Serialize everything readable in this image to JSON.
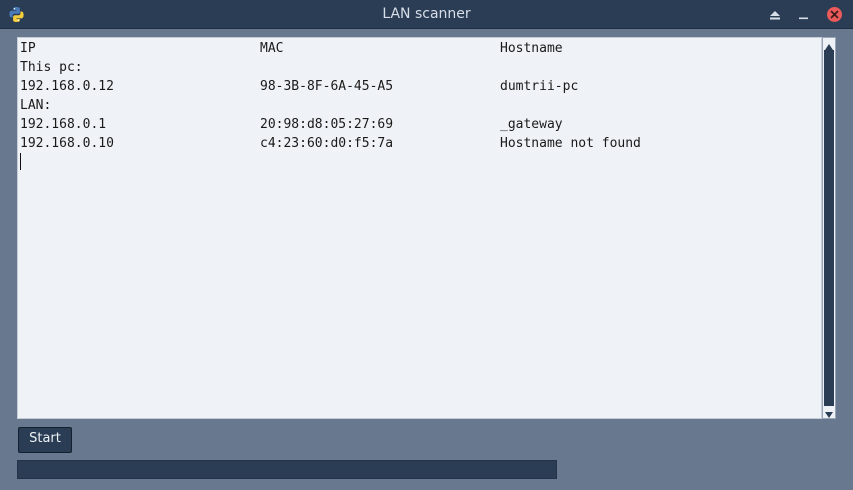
{
  "window": {
    "title": "LAN scanner",
    "app_icon": "python-icon",
    "controls": [
      "keep-above-icon",
      "minimize-icon",
      "close-icon"
    ]
  },
  "output": {
    "header": {
      "ip": "IP",
      "mac": "MAC",
      "hostname": "Hostname"
    },
    "this_pc_label": "This pc:",
    "this_pc": {
      "ip": "192.168.0.12",
      "mac": "98-3B-8F-6A-45-A5",
      "hostname": "dumtrii-pc"
    },
    "lan_label": "LAN:",
    "lan": [
      {
        "ip": "192.168.0.1",
        "mac": "20:98:d8:05:27:69",
        "hostname": "_gateway"
      },
      {
        "ip": "192.168.0.10",
        "mac": "c4:23:60:d0:f5:7a",
        "hostname": "Hostname not found"
      }
    ]
  },
  "controls": {
    "start_label": "Start"
  },
  "progress": {
    "value": 0
  },
  "colors": {
    "titlebar": "#2a3d55",
    "window_bg": "#67788f",
    "text_bg": "#eff2f6",
    "button_bg": "#2a3d55",
    "close": "#ea5a5a"
  }
}
